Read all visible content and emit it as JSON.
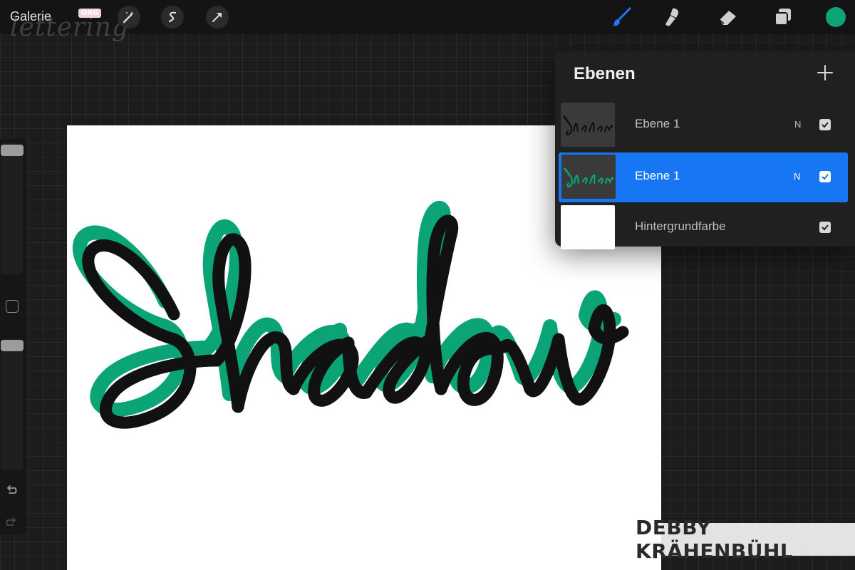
{
  "toolbar": {
    "gallery_label": "Galerie",
    "watermark_text": "lettering",
    "org_badge": "ORG",
    "left_tools": [
      "adjustments-icon",
      "selection-icon",
      "transform-icon"
    ],
    "right_tools": [
      "brush-icon",
      "smudge-icon",
      "eraser-icon",
      "layers-icon"
    ],
    "active_tool": "brush-icon",
    "current_color": "#0aa477",
    "active_color": "#1f79ff"
  },
  "sidebar": {
    "undo_icon": "undo-icon",
    "redo_icon": "redo-icon"
  },
  "canvas": {
    "artwork_text": "Shadow",
    "stroke_color": "#111111",
    "shadow_color": "#0aa477"
  },
  "layers": {
    "title": "Ebenen",
    "items": [
      {
        "name": "Ebene 1",
        "blend_mode": "N",
        "visible": true,
        "active": false
      },
      {
        "name": "Ebene 1",
        "blend_mode": "N",
        "visible": true,
        "active": true
      },
      {
        "name": "Hintergrundfarbe",
        "blend_mode": "",
        "visible": true,
        "active": false
      }
    ]
  },
  "watermark": {
    "text": "DEBBY KRÄHENBÜHL"
  }
}
